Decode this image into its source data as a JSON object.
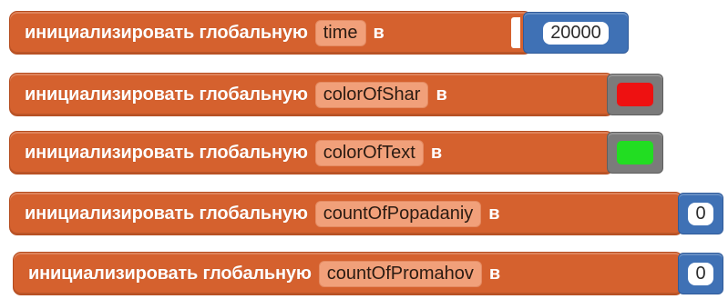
{
  "blocks": [
    {
      "label": "инициализировать глобальную",
      "var_name": "time",
      "in_label": "в",
      "value_type": "number",
      "value": "20000"
    },
    {
      "label": "инициализировать глобальную",
      "var_name": "colorOfShar",
      "in_label": "в",
      "value_type": "color",
      "color_hex": "#ee1111"
    },
    {
      "label": "инициализировать глобальную",
      "var_name": "colorOfText",
      "in_label": "в",
      "value_type": "color",
      "color_hex": "#22dd22"
    },
    {
      "label": "инициализировать глобальную",
      "var_name": "countOfPopadaniy",
      "in_label": "в",
      "value_type": "number",
      "value": "0"
    },
    {
      "label": "инициализировать глобальную",
      "var_name": "countOfPromahov",
      "in_label": "в",
      "value_type": "number",
      "value": "0"
    }
  ],
  "colors": {
    "variable_block": "#d5612e",
    "math_block": "#3f71b5",
    "color_block": "#7b7b7b"
  }
}
